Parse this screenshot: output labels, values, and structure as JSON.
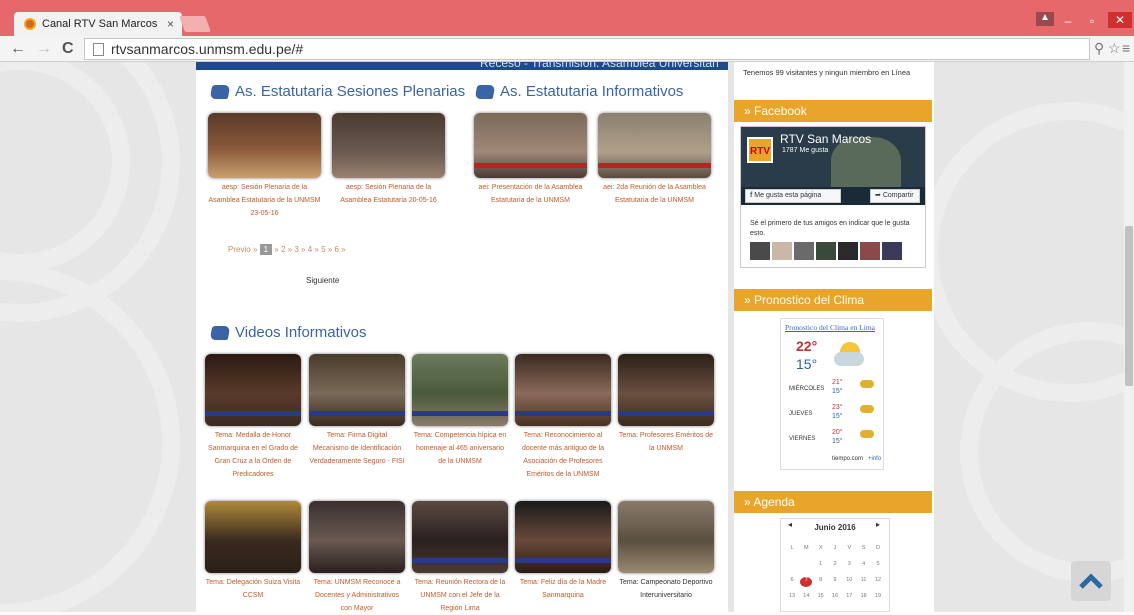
{
  "browser": {
    "tab_title": "Canal RTV San Marcos",
    "tab_close": "×",
    "url": "rtvsanmarcos.unmsm.edu.pe/#",
    "back": "←",
    "forward": "→",
    "reload": "C"
  },
  "banner_text": "Receso - Transmision: Asamblea Universitari",
  "sections": {
    "plenarias": {
      "title": "As. Estatutaria Sesiones Plenarias",
      "items": [
        {
          "caption": "aesp: Sesión Plenaria de la Asamblea Estatutaria de la UNMSM 23-05-16"
        },
        {
          "caption": "aesp: Sesión Plenaria de la Asamblea Estatutaria 20-05-16"
        }
      ]
    },
    "informativos": {
      "title": "As. Estatutaria Informativos",
      "items": [
        {
          "caption": "aei: Presentación de la Asamblea Estatutaria de la UNMSM"
        },
        {
          "caption": "aei: 2da Reunión de la Asamblea Estatutaria de la UNMSM"
        }
      ]
    },
    "videos": {
      "title": "Videos Informativos",
      "items": [
        {
          "caption": "Tema: Medalla de Honor Sanmarquina en el Grado de Gran Cruz a la Orden de Predicadores"
        },
        {
          "caption": "Tema: Firma Digital Mecanismo de Identificación Verdaderamente Seguro - FISI"
        },
        {
          "caption": "Tema: Competencia hípica en homenaje al 465 aniversario de la UNMSM"
        },
        {
          "caption": "Tema: Reconocimiento al docente más antiguo de la Asociación de Profesores Eméritos de la UNMSM"
        },
        {
          "caption": "Tema: Profesores Eméritos de la UNMSM"
        },
        {
          "caption": "Tema: Delegación Suiza Visita CCSM"
        },
        {
          "caption": "Tema: UNMSM Reconoce a Docentes y Administrativos con Mayor"
        },
        {
          "caption": "Tema: Reunión Rectora de la UNMSM con el Jefe de la Región Lima"
        },
        {
          "caption": "Tema: Feliz día de la Madre Sanmarquina"
        },
        {
          "caption": "Tema: Campeonato Deportivo Interuniversitario"
        }
      ]
    }
  },
  "pager": {
    "prev": "Previo",
    "sep": "»",
    "pages": [
      "1",
      "2",
      "3",
      "4",
      "5",
      "6"
    ],
    "next": "Siguiente"
  },
  "sidebar": {
    "visitors": "Tenemos 99 visitantes y ningun miembro en Línea",
    "facebook": {
      "heading": "Facebook",
      "page_name": "RTV San Marcos",
      "likes": "1787 Me gusta",
      "like_button": "Me gusta esta página",
      "share_button": "Compartir",
      "friends_text": "Sé el primero de tus amigos en indicar que le gusta esto.",
      "logo_text": "RTV"
    },
    "clima": {
      "heading": "Pronostico del Clima",
      "link": "Pronostico del Clima en Lima",
      "today_high": "22°",
      "today_low": "15°",
      "days": [
        {
          "name": "MIÉRCOLES",
          "high": "21°",
          "low": "15°"
        },
        {
          "name": "JUEVES",
          "high": "23°",
          "low": "15°"
        },
        {
          "name": "VIERNES",
          "high": "20°",
          "low": "15°"
        }
      ],
      "source": "tiempo.com",
      "info": "+info"
    },
    "agenda": {
      "heading": "Agenda",
      "month": "Junio 2016",
      "weekdays": [
        "L",
        "M",
        "X",
        "J",
        "V",
        "S",
        "D"
      ],
      "weeks": [
        [
          "",
          "",
          "1",
          "2",
          "3",
          "4",
          "5"
        ],
        [
          "6",
          "7",
          "8",
          "9",
          "10",
          "11",
          "12"
        ],
        [
          "13",
          "14",
          "15",
          "16",
          "17",
          "18",
          "19"
        ]
      ],
      "today": "7"
    }
  },
  "colors": {
    "titlebar": "#e7686a",
    "link": "#c25b2c",
    "heading": "#3a64a6",
    "sidebar_head": "#e8a52a"
  }
}
